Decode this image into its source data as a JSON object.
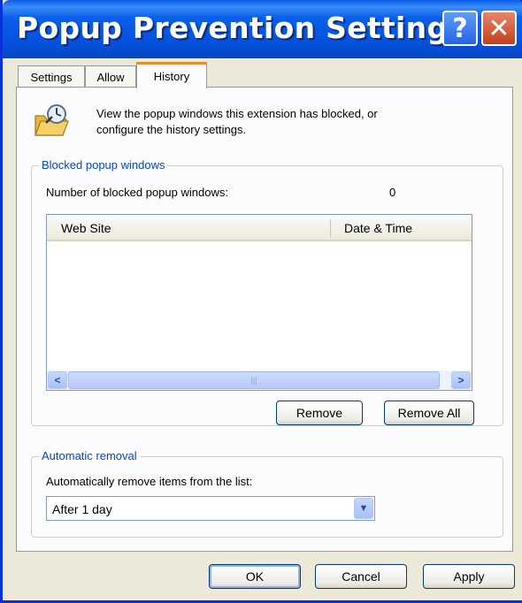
{
  "window": {
    "title": "Popup Prevention Settings",
    "help_glyph": "?",
    "close_glyph": "✕"
  },
  "tabs": [
    {
      "label": "Settings",
      "active": false
    },
    {
      "label": "Allow",
      "active": false
    },
    {
      "label": "History",
      "active": true
    }
  ],
  "history": {
    "description_line1": "View the popup windows this extension has blocked, or",
    "description_line2": "configure the history settings.",
    "icon": "folder-history-icon"
  },
  "blocked_group": {
    "legend": "Blocked popup windows",
    "count_label": "Number of blocked popup windows:",
    "count_value": "0",
    "columns": [
      "Web Site",
      "Date & Time"
    ],
    "rows": [],
    "remove_label": "Remove",
    "remove_all_label": "Remove All"
  },
  "removal_group": {
    "legend": "Automatic removal",
    "prompt": "Automatically remove items from the list:",
    "selected": "After 1 day"
  },
  "footer": {
    "ok_label": "OK",
    "cancel_label": "Cancel",
    "apply_label": "Apply"
  },
  "colors": {
    "title_bar": "#0652e0",
    "accent_tab": "#e68b2c",
    "legend_text": "#0046d5",
    "dialog_bg": "#ece9d8"
  }
}
